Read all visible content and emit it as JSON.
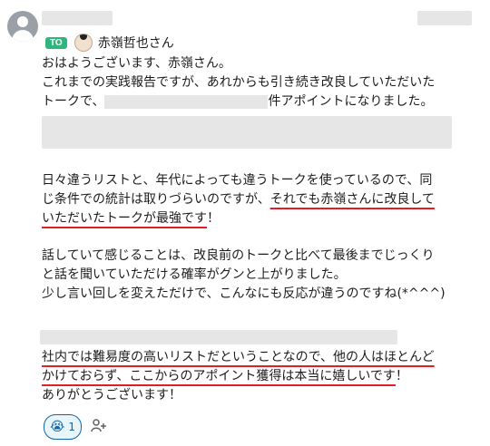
{
  "mention": {
    "badge": "TO",
    "name": "赤嶺哲也さん"
  },
  "message": {
    "line1": "おはようございます、赤嶺さん。",
    "line2": "これまでの実践報告ですが、あれからも引き続き改良していただいた",
    "line3a": "トークで、",
    "line3b": "件アポイントになりました。",
    "p2l1": "日々違うリストと、年代によっても違うトークを使っているので、同",
    "p2l2a": "じ条件での統計は取りづらいのですが、",
    "p2l2b": "それでも赤嶺さんに改良して",
    "p2l3a": "いただいたトークが最強です",
    "p2l3b": "！",
    "p3l1": "話していて感じることは、改良前のトークと比べて最後までじっくり",
    "p3l2": "と話を聞いていただける確率がグンと上がりました。",
    "p3l3": "少し言い回しを変えただけで、こんなにも反応が違うのですね(*^^^)",
    "p4l1a": "社内では難易度の高いリストだということなので、",
    "p4l1b": "他の人はほとんど",
    "p4l2a": "かけておらず、ここからのアポイント獲得は本当に嬉しいです",
    "p4l2b": "！",
    "p4l3": "ありがとうございます！"
  },
  "reaction": {
    "emoji": "😭",
    "count": "1"
  },
  "add_reaction_icon": "add-reaction-icon"
}
